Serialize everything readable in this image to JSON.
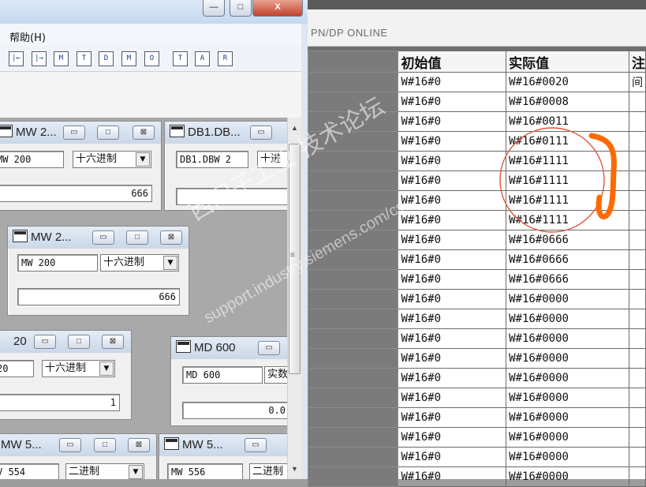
{
  "left_window": {
    "caption_buttons": {
      "minimize": "—",
      "maximize": "□",
      "close": "X"
    },
    "menu": {
      "help": "帮助(H)"
    },
    "toolbar_icons": [
      "|←",
      "|→",
      "M",
      "T",
      "D",
      "M",
      "O",
      "T",
      "A",
      "R"
    ],
    "var_tables": [
      {
        "title": "MW  2...",
        "address": "MW  200",
        "format": "十六进制",
        "value": "666"
      },
      {
        "title": "DB1.DB...",
        "address": "DB1.DBW  2",
        "format": "十进",
        "value": ""
      },
      {
        "title": "MW  2...",
        "address": "MW  200",
        "format": "十六进制",
        "value": "666"
      },
      {
        "title": "20",
        "address": "20",
        "format": "十六进制",
        "value": "1"
      },
      {
        "title": "MD  600",
        "address": "MD  600",
        "format": "实数",
        "value": "0.0"
      },
      {
        "title": "MW  5...",
        "address": "V  554",
        "format": "二进制",
        "value": ""
      },
      {
        "title": "MW  5...",
        "address": "MW  556",
        "format": "二进制",
        "value": ""
      }
    ]
  },
  "right_window": {
    "status": "PN/DP  ONLINE",
    "columns": [
      "",
      "初始值",
      "实际值",
      "注"
    ],
    "rows": [
      {
        "initial": "W#16#0",
        "actual": "W#16#0020",
        "extra": "间"
      },
      {
        "initial": "W#16#0",
        "actual": "W#16#0008",
        "extra": ""
      },
      {
        "initial": "W#16#0",
        "actual": "W#16#0011",
        "extra": ""
      },
      {
        "initial": "W#16#0",
        "actual": "W#16#0111",
        "extra": ""
      },
      {
        "initial": "W#16#0",
        "actual": "W#16#1111",
        "extra": ""
      },
      {
        "initial": "W#16#0",
        "actual": "W#16#1111",
        "extra": ""
      },
      {
        "initial": "W#16#0",
        "actual": "W#16#1111",
        "extra": ""
      },
      {
        "initial": "W#16#0",
        "actual": "W#16#1111",
        "extra": ""
      },
      {
        "initial": "W#16#0",
        "actual": "W#16#0666",
        "extra": ""
      },
      {
        "initial": "W#16#0",
        "actual": "W#16#0666",
        "extra": ""
      },
      {
        "initial": "W#16#0",
        "actual": "W#16#0666",
        "extra": ""
      },
      {
        "initial": "W#16#0",
        "actual": "W#16#0000",
        "extra": ""
      },
      {
        "initial": "W#16#0",
        "actual": "W#16#0000",
        "extra": ""
      },
      {
        "initial": "W#16#0",
        "actual": "W#16#0000",
        "extra": ""
      },
      {
        "initial": "W#16#0",
        "actual": "W#16#0000",
        "extra": ""
      },
      {
        "initial": "W#16#0",
        "actual": "W#16#0000",
        "extra": ""
      },
      {
        "initial": "W#16#0",
        "actual": "W#16#0000",
        "extra": ""
      },
      {
        "initial": "W#16#0",
        "actual": "W#16#0000",
        "extra": ""
      },
      {
        "initial": "W#16#0",
        "actual": "W#16#0000",
        "extra": ""
      },
      {
        "initial": "W#16#0",
        "actual": "W#16#0000",
        "extra": ""
      },
      {
        "initial": "W#16#0",
        "actual": "W#16#0000",
        "extra": ""
      }
    ]
  },
  "watermark": {
    "line1": "西门子工业 技术论坛",
    "line2": "support.industry.siemens.com/cs"
  },
  "colors": {
    "annotation_red": "#e2563f",
    "annotation_orange": "#ff6a00"
  }
}
